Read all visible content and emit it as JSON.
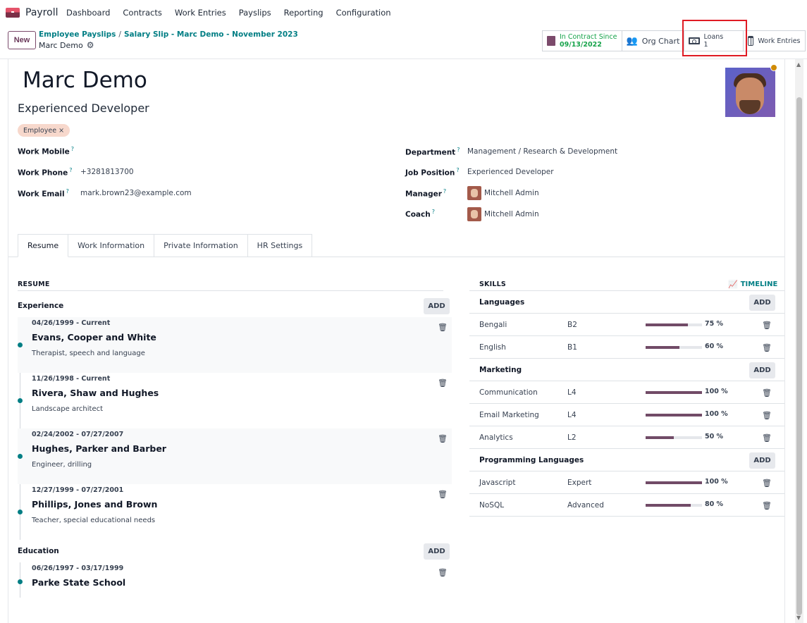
{
  "navbar": {
    "app_name": "Payroll",
    "menu": [
      "Dashboard",
      "Contracts",
      "Work Entries",
      "Payslips",
      "Reporting",
      "Configuration"
    ]
  },
  "control": {
    "new_label": "New",
    "breadcrumb": [
      "Employee Payslips",
      "Salary Slip - Marc Demo - November 2023"
    ],
    "current": "Marc Demo",
    "stats": {
      "contract_label": "In Contract Since",
      "contract_value": "09/13/2022",
      "orgchart_label": "Org Chart",
      "loans_label": "Loans",
      "loans_value": "1",
      "workentries_label": "Work Entries"
    }
  },
  "employee": {
    "name": "Marc Demo",
    "job_title": "Experienced Developer",
    "tag": "Employee",
    "tag_remove": "×",
    "status_color": "#d08b05",
    "fields": {
      "work_mobile_label": "Work Mobile",
      "work_mobile": "",
      "work_phone_label": "Work Phone",
      "work_phone": "+3281813700",
      "work_email_label": "Work Email",
      "work_email": "mark.brown23@example.com",
      "department_label": "Department",
      "department": "Management / Research & Development",
      "job_position_label": "Job Position",
      "job_position": "Experienced Developer",
      "manager_label": "Manager",
      "manager": "Mitchell Admin",
      "coach_label": "Coach",
      "coach": "Mitchell Admin",
      "help_mark": "?"
    }
  },
  "tabs": [
    "Resume",
    "Work Information",
    "Private Information",
    "HR Settings"
  ],
  "resume": {
    "title": "RESUME",
    "add_label": "ADD",
    "experience_label": "Experience",
    "experience": [
      {
        "date": "04/26/1999 - Current",
        "title": "Evans, Cooper and White",
        "desc": "Therapist, speech and language"
      },
      {
        "date": "11/26/1998 - Current",
        "title": "Rivera, Shaw and Hughes",
        "desc": "Landscape architect"
      },
      {
        "date": "02/24/2002 - 07/27/2007",
        "title": "Hughes, Parker and Barber",
        "desc": "Engineer, drilling"
      },
      {
        "date": "12/27/1999 - 07/27/2001",
        "title": "Phillips, Jones and Brown",
        "desc": "Teacher, special educational needs"
      }
    ],
    "education_label": "Education",
    "education": [
      {
        "date": "06/26/1997 - 03/17/1999",
        "title": "Parke State School"
      }
    ]
  },
  "skills": {
    "title": "SKILLS",
    "timeline_label": "TIMELINE",
    "add_label": "ADD",
    "groups": [
      {
        "name": "Languages",
        "items": [
          {
            "name": "Bengali",
            "level": "B2",
            "progress": 75,
            "pct": "75 %"
          },
          {
            "name": "English",
            "level": "B1",
            "progress": 60,
            "pct": "60 %"
          }
        ]
      },
      {
        "name": "Marketing",
        "items": [
          {
            "name": "Communication",
            "level": "L4",
            "progress": 100,
            "pct": "100 %"
          },
          {
            "name": "Email Marketing",
            "level": "L4",
            "progress": 100,
            "pct": "100 %"
          },
          {
            "name": "Analytics",
            "level": "L2",
            "progress": 50,
            "pct": "50 %"
          }
        ]
      },
      {
        "name": "Programming Languages",
        "items": [
          {
            "name": "Javascript",
            "level": "Expert",
            "progress": 100,
            "pct": "100 %"
          },
          {
            "name": "NoSQL",
            "level": "Advanced",
            "progress": 80,
            "pct": "80 %"
          }
        ]
      }
    ]
  }
}
